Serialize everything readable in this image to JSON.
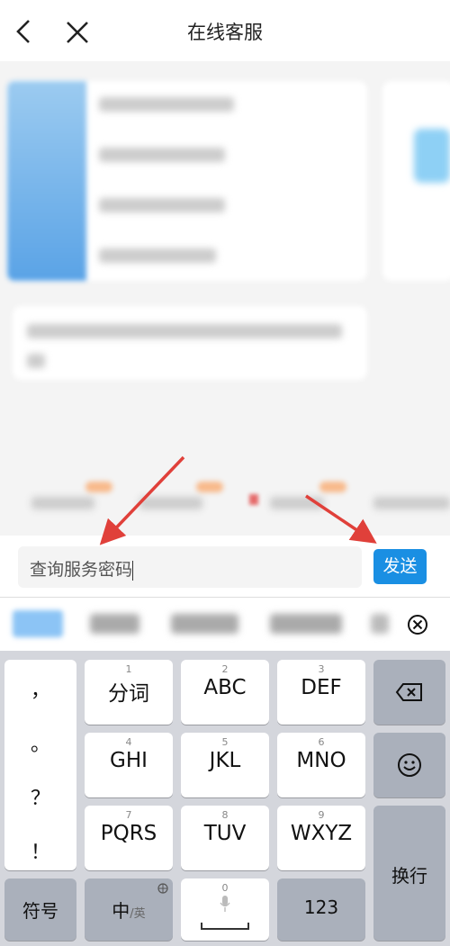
{
  "header": {
    "title": "在线客服",
    "back_icon": "chevron-left-icon",
    "close_icon": "close-icon"
  },
  "input": {
    "value": "查询服务密码",
    "send_label": "发送"
  },
  "colors": {
    "accent": "#1a8fe3",
    "arrow": "#e0403a",
    "keyboard_bg": "#d4d6dc"
  },
  "keyboard": {
    "punct": [
      "，",
      "。",
      "？",
      "！"
    ],
    "keys": [
      {
        "num": "1",
        "label": "分词"
      },
      {
        "num": "2",
        "label": "ABC"
      },
      {
        "num": "3",
        "label": "DEF"
      },
      {
        "num": "4",
        "label": "GHI"
      },
      {
        "num": "5",
        "label": "JKL"
      },
      {
        "num": "6",
        "label": "MNO"
      },
      {
        "num": "7",
        "label": "PQRS"
      },
      {
        "num": "8",
        "label": "TUV"
      },
      {
        "num": "9",
        "label": "WXYZ"
      }
    ],
    "symbols": "符号",
    "lang_main": "中",
    "lang_alt": "/英",
    "space_num": "0",
    "numbers": "123",
    "enter": "换行"
  }
}
